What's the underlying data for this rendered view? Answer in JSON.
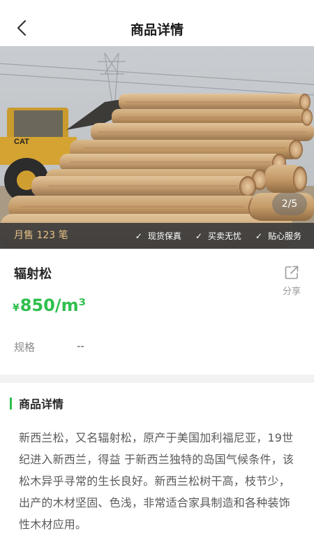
{
  "navbar": {
    "title": "商品详情",
    "back_icon": "chevron-left-icon"
  },
  "gallery": {
    "page_indicator": "2/5",
    "image_subject": "stacked radiata pine logs with loader"
  },
  "sales_bar": {
    "monthly_sales": "月售 123 笔",
    "guarantees": [
      "现货保真",
      "买卖无忧",
      "贴心服务"
    ],
    "accent_color": "#e7c287"
  },
  "product": {
    "name": "辐射松",
    "currency": "¥",
    "price": "850",
    "unit": "/m³",
    "price_color": "#2fbf4c",
    "share_label": "分享",
    "share_icon": "share-icon",
    "spec_label": "规格",
    "spec_value": "--"
  },
  "details": {
    "title": "商品详情",
    "text": "新西兰松，又名辐射松，原产于美国加利福尼亚，19世纪进入新西兰，得益  于新西兰独特的岛国气候条件，该松木异乎寻常的生长良好。新西兰松树干高，枝节少，出产的木材坚固、色浅，非常适合家具制造和各种装饰性木材应用。",
    "accent_color": "#2fbf4c"
  }
}
